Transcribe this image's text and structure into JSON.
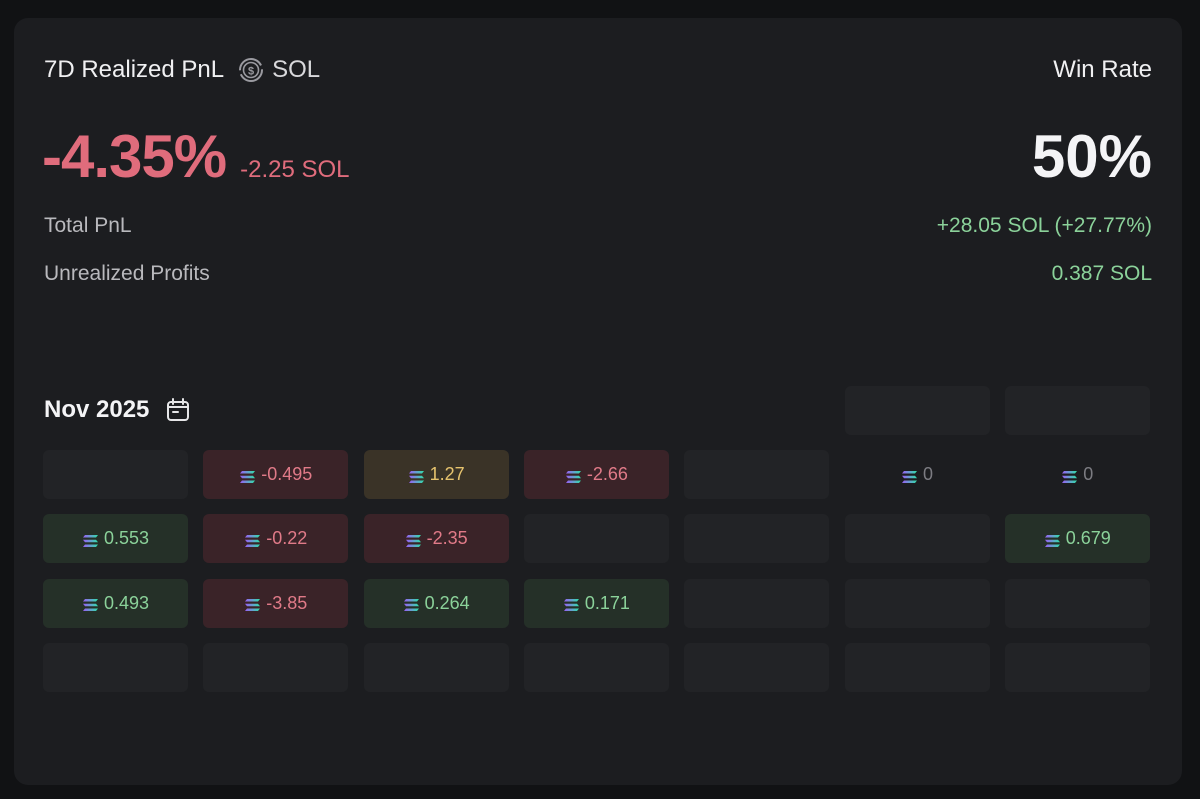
{
  "header": {
    "title": "7D Realized PnL",
    "currency": "SOL",
    "win_rate_label": "Win Rate"
  },
  "pnl": {
    "percent": "-4.35%",
    "sol": "-2.25 SOL",
    "win_rate": "50%"
  },
  "stats": [
    {
      "label": "Total PnL",
      "value": "+28.05 SOL (+27.77%)"
    },
    {
      "label": "Unrealized Profits",
      "value": "0.387 SOL"
    }
  ],
  "calendar": {
    "month": "Nov 2025",
    "rows": [
      [
        {
          "v": ""
        },
        {
          "v": ""
        },
        {
          "v": ""
        },
        {
          "v": ""
        },
        {
          "v": ""
        },
        {
          "v": "",
          "t": "empty"
        },
        {
          "v": "",
          "t": "empty"
        }
      ],
      [
        {
          "v": "",
          "t": "empty"
        },
        {
          "v": "-0.495",
          "t": "neg"
        },
        {
          "v": "1.27",
          "t": "yellow"
        },
        {
          "v": "-2.66",
          "t": "neg"
        },
        {
          "v": "",
          "t": "empty"
        },
        {
          "v": "0",
          "t": "zero"
        },
        {
          "v": "0",
          "t": "zero"
        }
      ],
      [
        {
          "v": "0.553",
          "t": "pos"
        },
        {
          "v": "-0.22",
          "t": "neg"
        },
        {
          "v": "-2.35",
          "t": "neg"
        },
        {
          "v": "",
          "t": "empty"
        },
        {
          "v": "",
          "t": "empty"
        },
        {
          "v": "",
          "t": "empty"
        },
        {
          "v": "0.679",
          "t": "pos"
        }
      ],
      [
        {
          "v": "0.493",
          "t": "pos"
        },
        {
          "v": "-3.85",
          "t": "neg"
        },
        {
          "v": "0.264",
          "t": "pos"
        },
        {
          "v": "0.171",
          "t": "pos"
        },
        {
          "v": "",
          "t": "empty"
        },
        {
          "v": "",
          "t": "empty"
        },
        {
          "v": "",
          "t": "empty"
        }
      ],
      [
        {
          "v": "",
          "t": "empty"
        },
        {
          "v": "",
          "t": "empty"
        },
        {
          "v": "",
          "t": "empty"
        },
        {
          "v": "",
          "t": "empty"
        },
        {
          "v": "",
          "t": "empty"
        },
        {
          "v": "",
          "t": "empty"
        },
        {
          "v": "",
          "t": "empty"
        }
      ]
    ]
  },
  "colors": {
    "negative": "#e06c7c",
    "positive": "#8bd29a",
    "neutral": "#e6c36e"
  },
  "icons": [
    "currency-swap-icon",
    "calendar-icon",
    "solana-icon"
  ]
}
